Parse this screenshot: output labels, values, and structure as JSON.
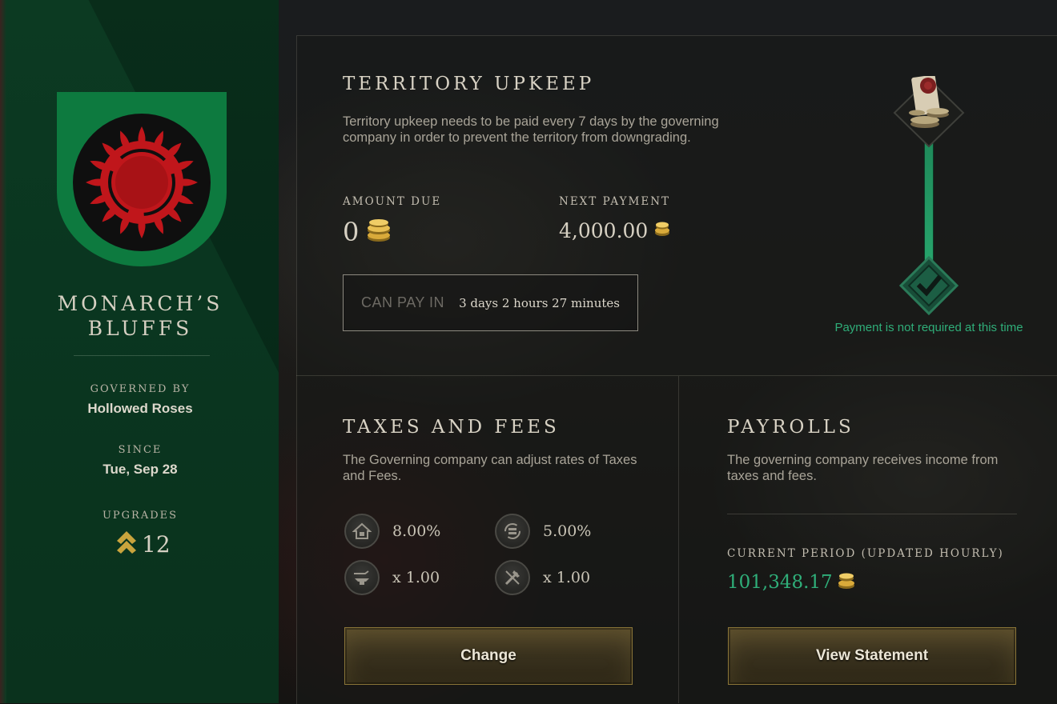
{
  "territory": {
    "name": "MONARCH’S BLUFFS",
    "governed_by_label": "GOVERNED BY",
    "governed_by": "Hollowed Roses",
    "since_label": "SINCE",
    "since": "Tue, Sep 28",
    "upgrades_label": "UPGRADES",
    "upgrades": "12",
    "banner_color": "#0d7a3f",
    "emblem_color": "#c0161b"
  },
  "upkeep": {
    "title": "TERRITORY UPKEEP",
    "description": "Territory upkeep needs to be paid every 7 days by the governing company in order to prevent the territory from downgrading.",
    "amount_due_label": "AMOUNT DUE",
    "amount_due": "0",
    "next_payment_label": "NEXT PAYMENT",
    "next_payment": "4,000.00",
    "can_pay_label": "CAN PAY IN",
    "can_pay_value": "3 days 2 hours 27 minutes",
    "status_note": "Payment is not required at this time",
    "status_color": "#2fae79"
  },
  "taxes": {
    "title": "TAXES AND FEES",
    "description": "The Governing company can adjust rates of Taxes and Fees.",
    "rates": [
      {
        "icon": "house-tax-icon",
        "value": "8.00%"
      },
      {
        "icon": "trade-tax-icon",
        "value": "5.00%"
      },
      {
        "icon": "crafting-fee-icon",
        "value": "x 1.00"
      },
      {
        "icon": "refining-fee-icon",
        "value": "x 1.00"
      }
    ],
    "button_label": "Change"
  },
  "payrolls": {
    "title": "PAYROLLS",
    "description": "The governing company receives income from taxes and fees.",
    "period_label": "CURRENT PERIOD (UPDATED HOURLY)",
    "period_value": "101,348.17",
    "button_label": "View Statement"
  }
}
